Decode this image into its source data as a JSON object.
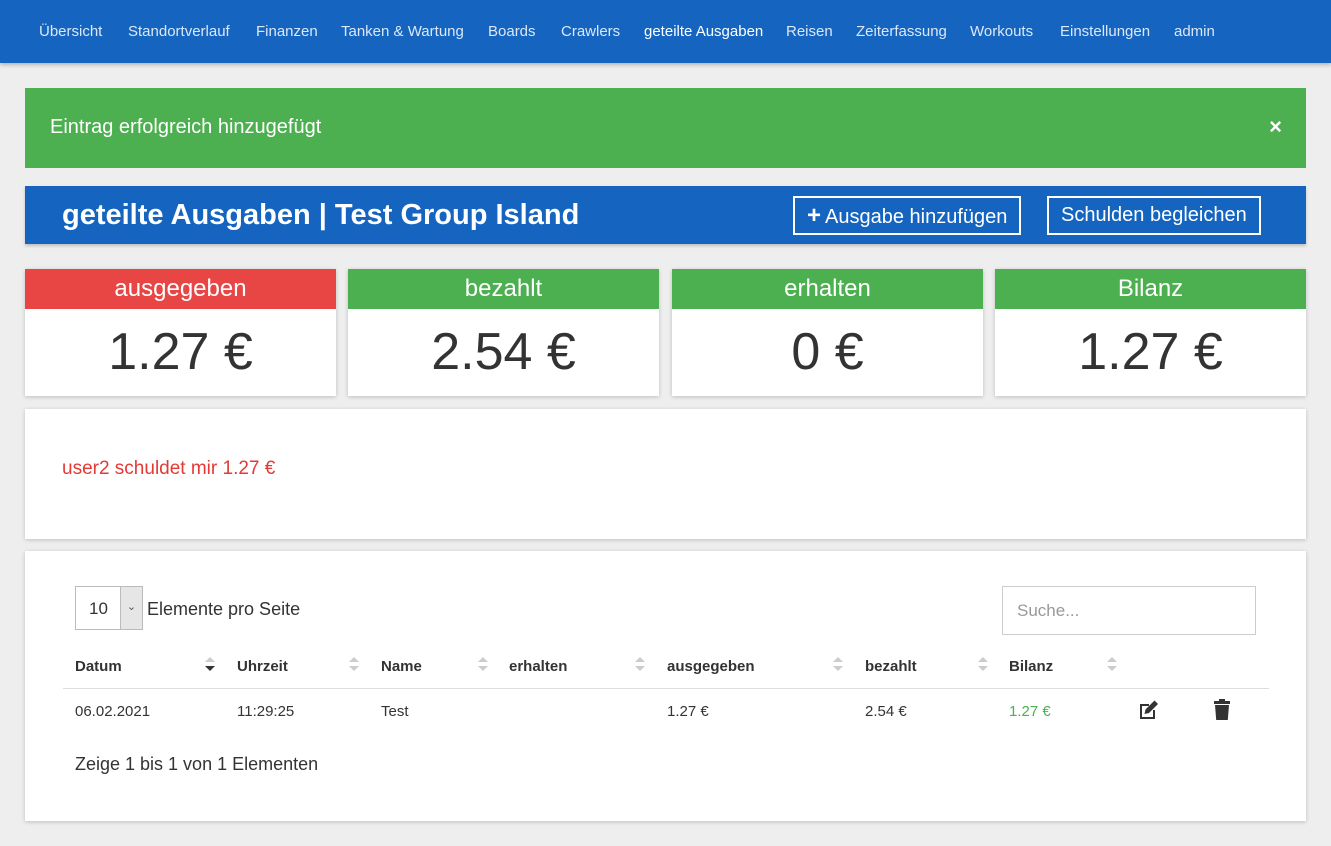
{
  "nav": {
    "items": [
      "Übersicht",
      "Standortverlauf",
      "Finanzen",
      "Tanken & Wartung",
      "Boards",
      "Crawlers",
      "geteilte Ausgaben",
      "Reisen",
      "Zeiterfassung",
      "Workouts",
      "Einstellungen",
      "admin"
    ],
    "active": "geteilte Ausgaben"
  },
  "alert": {
    "text": "Eintrag erfolgreich hinzugefügt",
    "close": "×"
  },
  "header": {
    "title": "geteilte Ausgaben | Test Group Island",
    "add_button": "Ausgabe hinzufügen",
    "settle_button": "Schulden begleichen"
  },
  "stats": [
    {
      "label": "ausgegeben",
      "value": "1.27 €",
      "color": "#e84545"
    },
    {
      "label": "bezahlt",
      "value": "2.54 €",
      "color": "#4caf50"
    },
    {
      "label": "erhalten",
      "value": "0 €",
      "color": "#4caf50"
    },
    {
      "label": "Bilanz",
      "value": "1.27 €",
      "color": "#4caf50"
    }
  ],
  "debt": {
    "text": "user2 schuldet mir 1.27 €",
    "color": "#e53935"
  },
  "table": {
    "page_size": "10",
    "page_size_label": "Elemente pro Seite",
    "search_placeholder": "Suche...",
    "columns": [
      "Datum",
      "Uhrzeit",
      "Name",
      "erhalten",
      "ausgegeben",
      "bezahlt",
      "Bilanz"
    ],
    "sorted_column": "Datum",
    "rows": [
      {
        "datum": "06.02.2021",
        "uhrzeit": "11:29:25",
        "name": "Test",
        "erhalten": "",
        "ausgegeben": "1.27 €",
        "bezahlt": "2.54 €",
        "bilanz": "1.27 €"
      }
    ],
    "row_icons": [
      "edit-icon",
      "trash-icon"
    ],
    "info": "Zeige 1 bis 1 von 1 Elementen"
  }
}
